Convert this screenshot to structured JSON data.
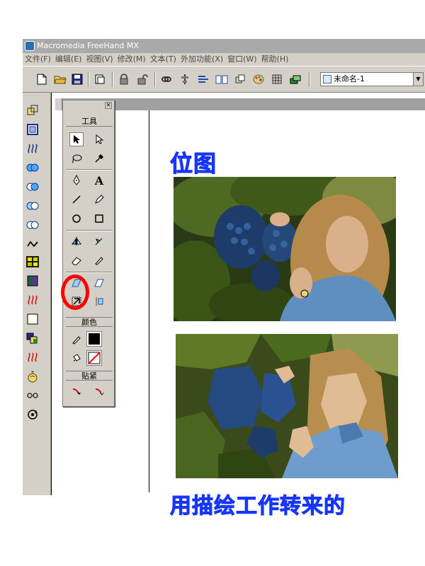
{
  "window": {
    "title": "Macromedia FreeHand MX"
  },
  "menu": {
    "items": [
      "文件(F)",
      "编辑(E)",
      "视图(V)",
      "修改(M)",
      "文本(T)",
      "外加功能(X)",
      "窗口(W)",
      "帮助(H)"
    ]
  },
  "toolbar": {
    "document_select": "未命名-1",
    "icons": [
      "new-file-icon",
      "open-folder-icon",
      "save-icon",
      "import-icon",
      "lock-icon",
      "unlock-icon",
      "link-icon",
      "align-icon",
      "text-wrap-icon",
      "library-icon",
      "symbol-icon",
      "color-mixer-icon",
      "grid-icon",
      "layers-icon"
    ]
  },
  "left_strip": {
    "icons": [
      "transform-icon",
      "group-icon",
      "blend-icon",
      "union-icon",
      "intersect-icon",
      "punch-icon",
      "crop-icon",
      "curve-icon",
      "mosaic-icon",
      "gradient-icon",
      "split-icon",
      "white-fill-icon",
      "trap-icon",
      "split-path-icon",
      "bomb-icon",
      "chain-icon",
      "rotate-icon"
    ]
  },
  "tools_panel": {
    "header_tools": "工具",
    "header_colors": "颜色",
    "header_snap": "贴紧",
    "close_label": "×",
    "tools": [
      "pointer-tool-icon",
      "subselect-tool-icon",
      "lasso-tool-icon",
      "eyedropper-tool-icon",
      "pen-tool-icon",
      "text-tool-icon",
      "line-tool-icon",
      "pencil-tool-icon",
      "ellipse-tool-icon",
      "rectangle-tool-icon",
      "mirror-tool-icon",
      "reflect-tool-icon",
      "eraser-tool-icon",
      "knife-tool-icon",
      "perspective-tool-icon",
      "fisheye-tool-icon",
      "trace-tool-icon",
      "magic-wand-tool-icon"
    ]
  },
  "canvas": {
    "caption_top": "位图",
    "caption_bottom": "用描绘工作转来的"
  },
  "colors": {
    "caption": "#1636ff",
    "highlight": "#ff0000",
    "chrome": "#d4d0c8"
  }
}
